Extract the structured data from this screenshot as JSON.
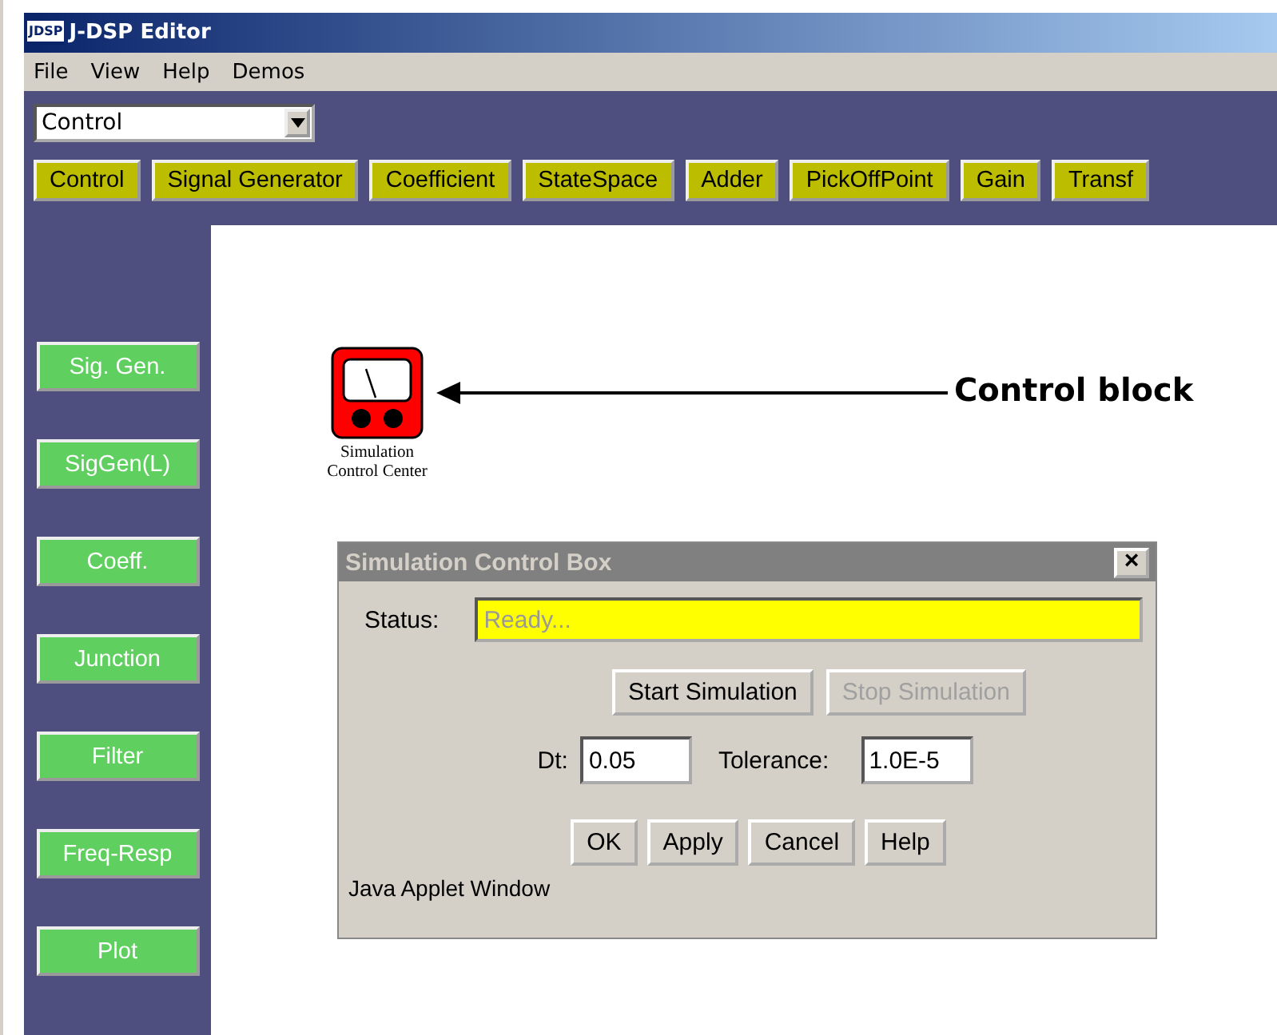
{
  "window": {
    "title": "J-DSP Editor",
    "logo": "JDSP"
  },
  "menu": [
    "File",
    "View",
    "Help",
    "Demos"
  ],
  "category_dropdown": {
    "value": "Control"
  },
  "toolbar": [
    "Control",
    "Signal Generator",
    "Coefficient",
    "StateSpace",
    "Adder",
    "PickOffPoint",
    "Gain",
    "Transf"
  ],
  "sidebar": [
    "Sig. Gen.",
    "SigGen(L)",
    "Coeff.",
    "Junction",
    "Filter",
    "Freq-Resp",
    "Plot"
  ],
  "canvas": {
    "block": {
      "label_lines": [
        "Simulation",
        "Control Center"
      ]
    },
    "annotation": "Control block"
  },
  "dialog": {
    "title": "Simulation Control Box",
    "close": "×",
    "status_label": "Status:",
    "status_value": "Ready...",
    "sim_buttons": [
      {
        "label": "Start Simulation",
        "disabled": false
      },
      {
        "label": "Stop Simulation",
        "disabled": true
      }
    ],
    "dt_label": "Dt:",
    "dt_value": "0.05",
    "tolerance_label": "Tolerance:",
    "tolerance_value": "1.0E-5",
    "buttons": [
      "OK",
      "Apply",
      "Cancel",
      "Help"
    ],
    "footer": "Java Applet Window"
  }
}
